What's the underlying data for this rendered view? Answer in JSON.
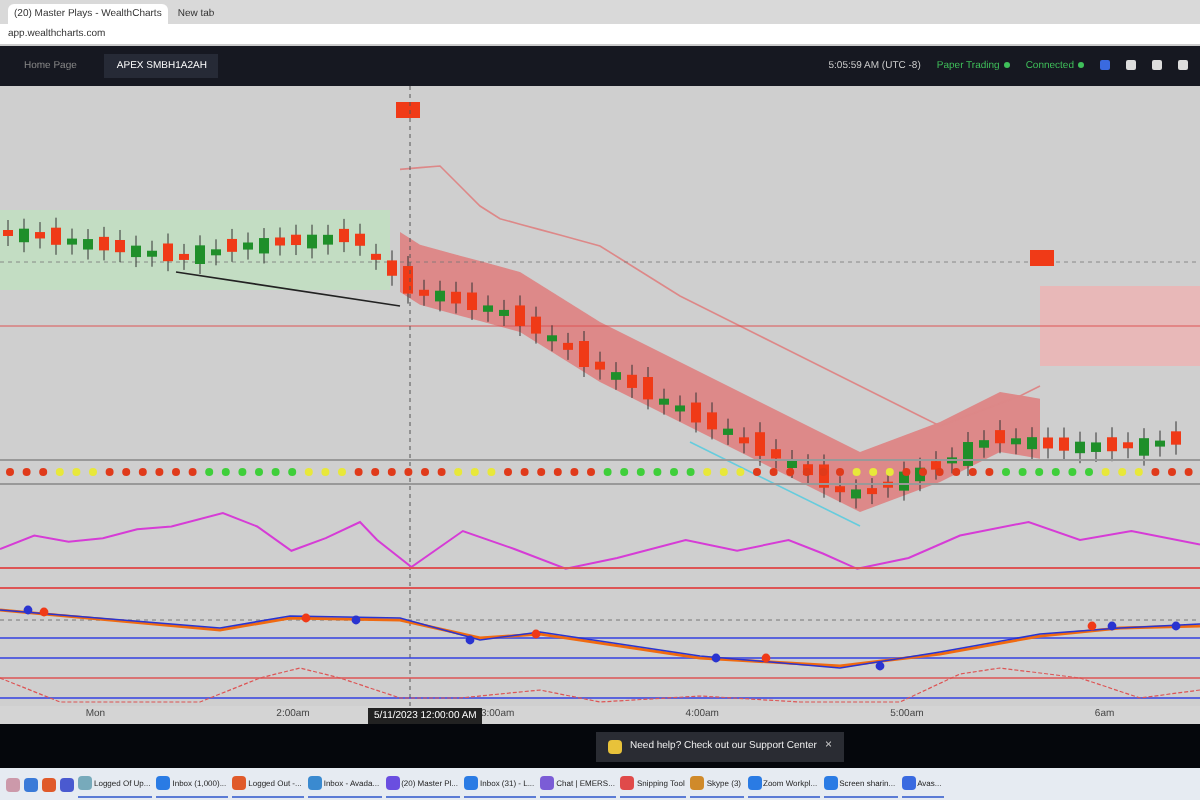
{
  "browser": {
    "tabs": [
      {
        "label": "(20) Master Plays - WealthCharts",
        "selected": true
      },
      {
        "label": "New tab",
        "selected": false
      }
    ],
    "url": "app.wealthcharts.com"
  },
  "app_header": {
    "tabs": [
      {
        "label": "Home Page",
        "selected": false
      },
      {
        "label": "APEX SMBH1A2AH",
        "selected": true
      }
    ],
    "status": [
      {
        "label": "5:05:59 AM (UTC -8)",
        "kind": "text"
      },
      {
        "label": "Paper Trading",
        "kind": "dot",
        "color": "#3fbf5a"
      },
      {
        "label": "Connected",
        "kind": "dot",
        "color": "#3fbf5a"
      }
    ]
  },
  "chart": {
    "x_labels": [
      "Mon",
      "2:00am",
      "3:00am",
      "4:00am",
      "5:00am",
      "6am"
    ],
    "crosshair_label": "5/11/2023 12:00:00 AM"
  },
  "toast": {
    "message": "Need help? Check out our Support Center",
    "close": "×"
  },
  "taskbar": {
    "items": [
      {
        "label": "Logged Of Up..."
      },
      {
        "label": "Inbox (1,000)..."
      },
      {
        "label": "Logged Out -..."
      },
      {
        "label": "Inbox - Avada..."
      },
      {
        "label": "(20) Master Pl..."
      },
      {
        "label": "Inbox (31) - L..."
      },
      {
        "label": "Chat | EMERS..."
      },
      {
        "label": "Snipping Tool"
      },
      {
        "label": "Skype (3)"
      },
      {
        "label": "Zoom Workpl..."
      },
      {
        "label": "Screen sharin..."
      },
      {
        "label": "Avas..."
      }
    ]
  }
}
